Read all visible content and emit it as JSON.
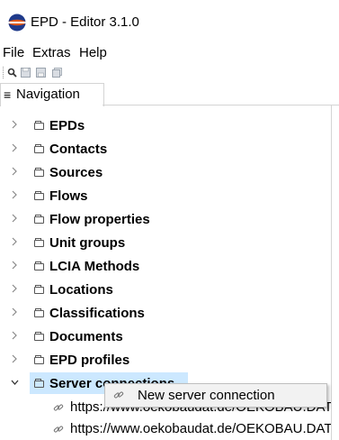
{
  "window": {
    "title": "EPD - Editor 3.1.0",
    "icon": "app-disc-icon"
  },
  "menubar": {
    "items": [
      "File",
      "Extras",
      "Help"
    ]
  },
  "toolbar": {
    "icons": [
      "search-icon",
      "save-icon",
      "save-as-icon",
      "save-all-icon"
    ]
  },
  "navigation": {
    "tab_label": "Navigation",
    "tab_icon": "≡",
    "items": [
      {
        "label": "EPDs",
        "expanded": false
      },
      {
        "label": "Contacts",
        "expanded": false
      },
      {
        "label": "Sources",
        "expanded": false
      },
      {
        "label": "Flows",
        "expanded": false
      },
      {
        "label": "Flow properties",
        "expanded": false
      },
      {
        "label": "Unit groups",
        "expanded": false
      },
      {
        "label": "LCIA Methods",
        "expanded": false
      },
      {
        "label": "Locations",
        "expanded": false
      },
      {
        "label": "Classifications",
        "expanded": false
      },
      {
        "label": "Documents",
        "expanded": false
      },
      {
        "label": "EPD profiles",
        "expanded": false
      },
      {
        "label": "Server connections",
        "expanded": true,
        "selected": true
      }
    ],
    "server_connections": [
      {
        "url": "https://www.oekobaudat.de/OEKOBAU.DAT"
      },
      {
        "url": "https://www.oekobaudat.de/OEKOBAU.DAT"
      }
    ]
  },
  "context_menu": {
    "items": [
      {
        "label": "New server connection",
        "icon": "link-icon"
      }
    ]
  },
  "colors": {
    "selection": "#cce8ff",
    "menu_bg": "#f2f2f2",
    "border": "#d4d4d4"
  }
}
